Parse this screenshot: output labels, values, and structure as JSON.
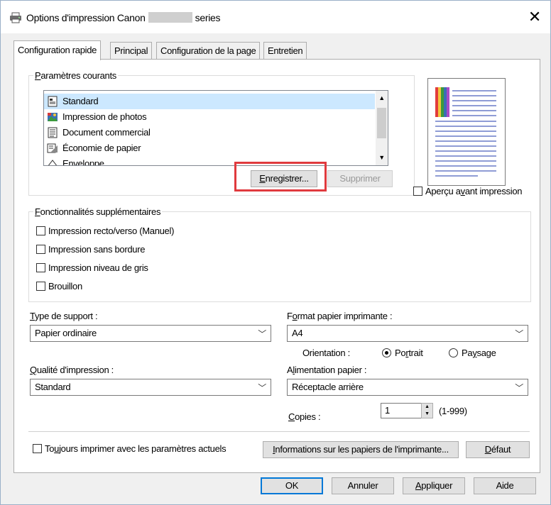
{
  "window": {
    "title_prefix": "Options d'impression Canon",
    "title_suffix": "series",
    "close_glyph": "✕"
  },
  "tabs": [
    {
      "label": "Configuration rapide",
      "active": true
    },
    {
      "label": "Principal",
      "active": false
    },
    {
      "label": "Configuration de la page",
      "active": false
    },
    {
      "label": "Entretien",
      "active": false
    }
  ],
  "current_settings": {
    "label_underline": "P",
    "label_rest": "aramètres courants",
    "items": [
      {
        "label": "Standard",
        "icon": "standard-doc-icon",
        "selected": true
      },
      {
        "label": "Impression de photos",
        "icon": "photo-print-icon",
        "selected": false
      },
      {
        "label": "Document commercial",
        "icon": "business-doc-icon",
        "selected": false
      },
      {
        "label": "Économie de papier",
        "icon": "paper-saving-icon",
        "selected": false
      },
      {
        "label": "Enveloppe",
        "icon": "envelope-icon",
        "selected": false
      }
    ],
    "save_button_underline": "E",
    "save_button_rest": "nregistrer...",
    "delete_button": "Supprimer"
  },
  "preview": {
    "checkbox_a": "Aperçu a",
    "checkbox_u": "v",
    "checkbox_b": "ant impression",
    "checked": false
  },
  "additional_features": {
    "label_underline": "F",
    "label_rest": "onctionnalités supplémentaires",
    "items": [
      {
        "label": "Impression recto/verso (Manuel)",
        "checked": false
      },
      {
        "label": "Impression sans bordure",
        "checked": false
      },
      {
        "label": "Impression niveau de gris",
        "checked": false
      },
      {
        "label": "Brouillon",
        "checked": false
      }
    ]
  },
  "media_type": {
    "label_underline": "T",
    "label_rest": "ype de support :",
    "value": "Papier ordinaire"
  },
  "printer_paper_size": {
    "label_a": "F",
    "label_u": "o",
    "label_b": "rmat papier imprimante :",
    "value": "A4"
  },
  "orientation": {
    "label": "Orientation :",
    "portrait_a": "Po",
    "portrait_u": "r",
    "portrait_b": "trait",
    "landscape_a": "Pa",
    "landscape_u": "y",
    "landscape_b": "sage",
    "selected": "portrait"
  },
  "print_quality": {
    "label_underline": "Q",
    "label_rest": "ualité d'impression :",
    "value": "Standard"
  },
  "paper_source": {
    "label_a": "A",
    "label_u": "l",
    "label_b": "imentation papier :",
    "value": "Réceptacle arrière"
  },
  "copies": {
    "label_underline": "C",
    "label_rest": "opies :",
    "value": "1",
    "range": "(1-999)"
  },
  "always_print": {
    "label_a": "To",
    "label_u": "u",
    "label_b": "jours imprimer avec les paramètres actuels",
    "checked": false
  },
  "paper_info_button": {
    "underline": "I",
    "rest": "nformations sur les papiers de l'imprimante..."
  },
  "default_button": {
    "underline": "D",
    "rest": "éfaut"
  },
  "footer": {
    "ok": "OK",
    "cancel": "Annuler",
    "apply_underline": "A",
    "apply_rest": "ppliquer",
    "help": "Aide"
  },
  "colors": {
    "highlight": "#e03a3e",
    "selection": "#cce8ff",
    "accent": "#0078d7"
  }
}
